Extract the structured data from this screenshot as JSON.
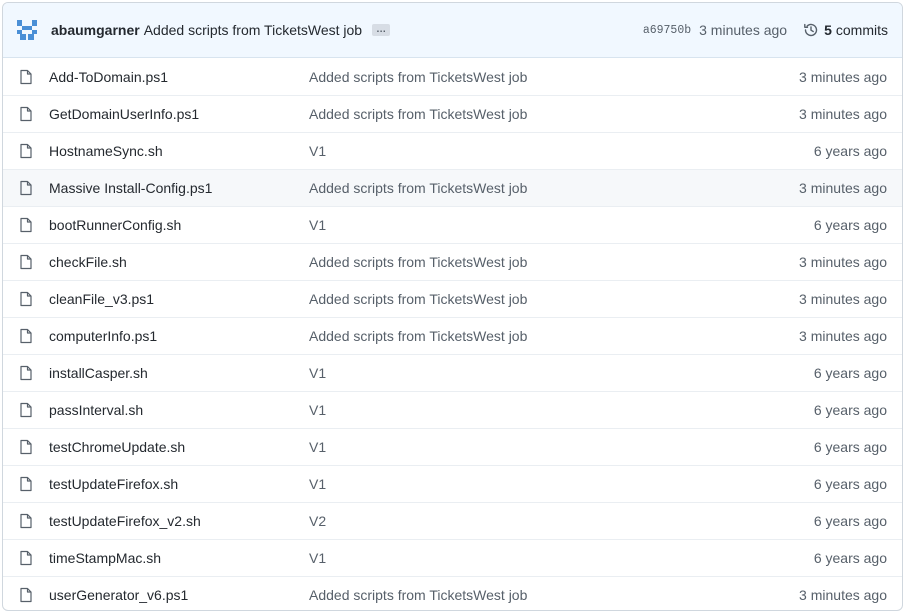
{
  "header": {
    "author": "abaumgarner",
    "message": "Added scripts from TicketsWest job",
    "ellipsis": "…",
    "sha": "a69750b",
    "time": "3 minutes ago",
    "commit_count": "5",
    "commits_label": "commits",
    "avatar_color": "#4a8fd6"
  },
  "files": [
    {
      "name": "Add-ToDomain.ps1",
      "message": "Added scripts from TicketsWest job",
      "time": "3 minutes ago"
    },
    {
      "name": "GetDomainUserInfo.ps1",
      "message": "Added scripts from TicketsWest job",
      "time": "3 minutes ago"
    },
    {
      "name": "HostnameSync.sh",
      "message": "V1",
      "time": "6 years ago"
    },
    {
      "name": "Massive Install-Config.ps1",
      "message": "Added scripts from TicketsWest job",
      "time": "3 minutes ago"
    },
    {
      "name": "bootRunnerConfig.sh",
      "message": "V1",
      "time": "6 years ago"
    },
    {
      "name": "checkFile.sh",
      "message": "Added scripts from TicketsWest job",
      "time": "3 minutes ago"
    },
    {
      "name": "cleanFile_v3.ps1",
      "message": "Added scripts from TicketsWest job",
      "time": "3 minutes ago"
    },
    {
      "name": "computerInfo.ps1",
      "message": "Added scripts from TicketsWest job",
      "time": "3 minutes ago"
    },
    {
      "name": "installCasper.sh",
      "message": "V1",
      "time": "6 years ago"
    },
    {
      "name": "passInterval.sh",
      "message": "V1",
      "time": "6 years ago"
    },
    {
      "name": "testChromeUpdate.sh",
      "message": "V1",
      "time": "6 years ago"
    },
    {
      "name": "testUpdateFirefox.sh",
      "message": "V1",
      "time": "6 years ago"
    },
    {
      "name": "testUpdateFirefox_v2.sh",
      "message": "V2",
      "time": "6 years ago"
    },
    {
      "name": "timeStampMac.sh",
      "message": "V1",
      "time": "6 years ago"
    },
    {
      "name": "userGenerator_v6.ps1",
      "message": "Added scripts from TicketsWest job",
      "time": "3 minutes ago"
    }
  ]
}
